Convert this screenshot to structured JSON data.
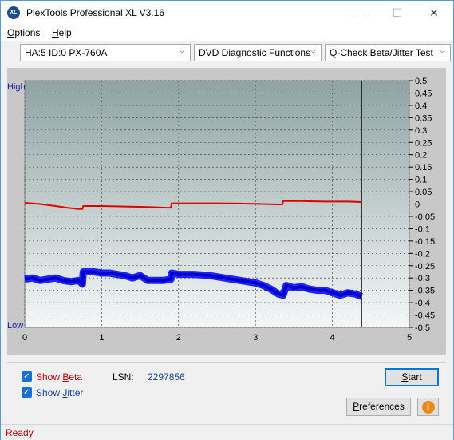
{
  "window": {
    "title": "PlexTools Professional XL V3.16",
    "icon_text": "XL",
    "minimize_glyph": "—",
    "maximize_glyph": "☐",
    "close_glyph": "✕"
  },
  "menu": {
    "options": {
      "first": "O",
      "rest": "ptions"
    },
    "help": {
      "first": "H",
      "rest": "elp"
    }
  },
  "toolbar": {
    "drive": "HA:5 ID:0  PX-760A",
    "function": "DVD Diagnostic Functions",
    "test": "Q-Check Beta/Jitter Test",
    "chevron": "⌵"
  },
  "chart_data": {
    "type": "line",
    "left_axis_labels": {
      "top": "High",
      "bottom": "Low"
    },
    "x_ticks": [
      "0",
      "1",
      "2",
      "3",
      "4",
      "5"
    ],
    "xlim": [
      0,
      5
    ],
    "y_ticks": [
      "0.5",
      "0.45",
      "0.4",
      "0.35",
      "0.3",
      "0.25",
      "0.2",
      "0.15",
      "0.1",
      "0.05",
      "0",
      "-0.05",
      "-0.1",
      "-0.15",
      "-0.2",
      "-0.25",
      "-0.3",
      "-0.35",
      "-0.4",
      "-0.45",
      "-0.5"
    ],
    "ylim": [
      -0.5,
      0.5
    ],
    "grid": true,
    "end_marker_x": 4.38,
    "colors": {
      "beta": "#e00000",
      "jitter": "#0000ff"
    },
    "series": [
      {
        "key": "beta",
        "x": [
          0.0,
          0.2,
          0.4,
          0.55,
          0.7,
          0.75,
          0.76,
          1.0,
          1.3,
          1.6,
          1.85,
          1.9,
          1.91,
          2.2,
          2.5,
          2.8,
          3.1,
          3.35,
          3.36,
          3.6,
          3.9,
          4.2,
          4.38
        ],
        "y": [
          0.005,
          0.0,
          -0.008,
          -0.015,
          -0.02,
          -0.02,
          -0.008,
          -0.008,
          -0.01,
          -0.012,
          -0.015,
          -0.015,
          0.003,
          0.003,
          0.003,
          0.002,
          0.0,
          -0.002,
          0.012,
          0.012,
          0.01,
          0.01,
          0.008
        ]
      },
      {
        "key": "jitter",
        "x": [
          0.0,
          0.1,
          0.2,
          0.3,
          0.4,
          0.5,
          0.6,
          0.7,
          0.75,
          0.76,
          0.9,
          1.0,
          1.1,
          1.2,
          1.3,
          1.4,
          1.5,
          1.6,
          1.7,
          1.8,
          1.9,
          1.91,
          2.0,
          2.2,
          2.4,
          2.6,
          2.8,
          3.0,
          3.1,
          3.2,
          3.3,
          3.36,
          3.4,
          3.5,
          3.6,
          3.7,
          3.8,
          3.9,
          4.0,
          4.1,
          4.2,
          4.3,
          4.38
        ],
        "y": [
          -0.305,
          -0.3,
          -0.31,
          -0.305,
          -0.3,
          -0.31,
          -0.315,
          -0.31,
          -0.325,
          -0.275,
          -0.275,
          -0.28,
          -0.28,
          -0.285,
          -0.29,
          -0.3,
          -0.29,
          -0.31,
          -0.31,
          -0.31,
          -0.305,
          -0.28,
          -0.285,
          -0.285,
          -0.29,
          -0.3,
          -0.31,
          -0.32,
          -0.33,
          -0.345,
          -0.365,
          -0.37,
          -0.33,
          -0.34,
          -0.335,
          -0.345,
          -0.35,
          -0.35,
          -0.36,
          -0.37,
          -0.36,
          -0.365,
          -0.375
        ]
      }
    ]
  },
  "controls": {
    "show_beta": {
      "first": "Show ",
      "accel": "B",
      "rest": "eta",
      "checked": true,
      "color": "#c00000"
    },
    "show_jitter": {
      "first": "Show ",
      "accel": "J",
      "rest": "itter",
      "checked": true,
      "color": "#1a3fa0"
    },
    "checkmark": "✓",
    "lsn_label": "LSN:",
    "lsn_value": "2297856",
    "start": {
      "accel": "S",
      "rest": "tart"
    },
    "preferences": {
      "first": "",
      "accel": "P",
      "rest": "references"
    },
    "info_glyph": "i"
  },
  "status": {
    "text": "Ready"
  }
}
